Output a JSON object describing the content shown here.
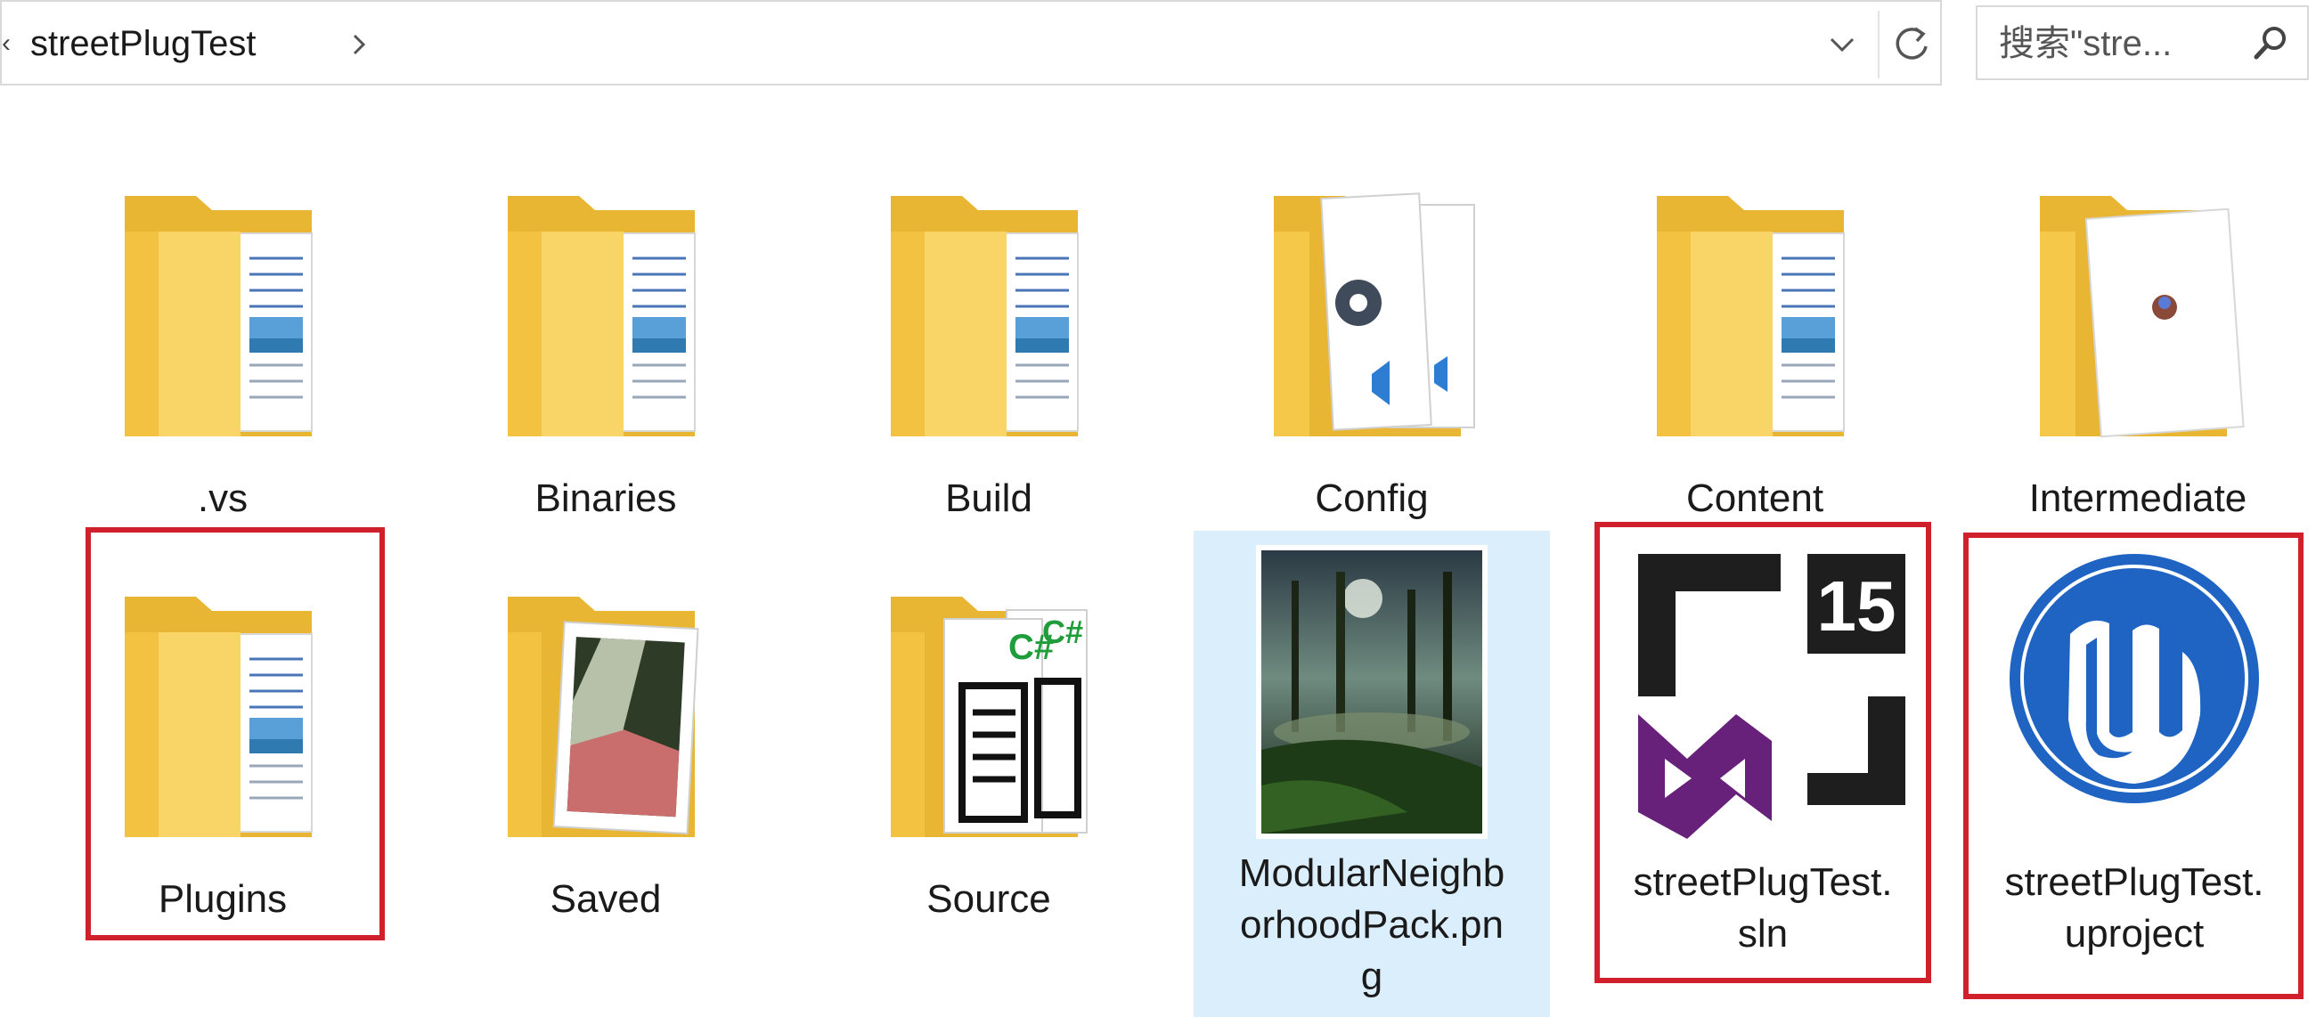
{
  "address_bar": {
    "breadcrumb": "streetPlugTest",
    "separator": "›",
    "dropdown_icon": "chevron-down-icon",
    "refresh_icon": "refresh-icon"
  },
  "search": {
    "placeholder": "搜索\"stre...",
    "icon": "search-icon"
  },
  "items": [
    {
      "name": ".vs",
      "type": "folder"
    },
    {
      "name": "Binaries",
      "type": "folder"
    },
    {
      "name": "Build",
      "type": "folder"
    },
    {
      "name": "Config",
      "type": "folder"
    },
    {
      "name": "Content",
      "type": "folder"
    },
    {
      "name": "Intermediate",
      "type": "folder"
    },
    {
      "name": "Plugins",
      "type": "folder",
      "highlighted": true
    },
    {
      "name": "Saved",
      "type": "folder"
    },
    {
      "name": "Source",
      "type": "folder"
    },
    {
      "name": "ModularNeighb",
      "name_line2": "orhoodPack.pn",
      "name_line3": "g",
      "type": "png-image",
      "selected": true
    },
    {
      "name": "streetPlugTest.",
      "name_line2": "sln",
      "type": "visual-studio-solution",
      "badge": "15",
      "highlighted": true
    },
    {
      "name": "streetPlugTest.",
      "name_line2": "uproject",
      "type": "unreal-project",
      "highlighted": true
    }
  ],
  "colors": {
    "highlight_box": "#d0202c",
    "selection": "#dbeefb",
    "folder": "#f7c948",
    "vs_purple": "#68217a",
    "unreal_blue": "#1f63c3"
  }
}
